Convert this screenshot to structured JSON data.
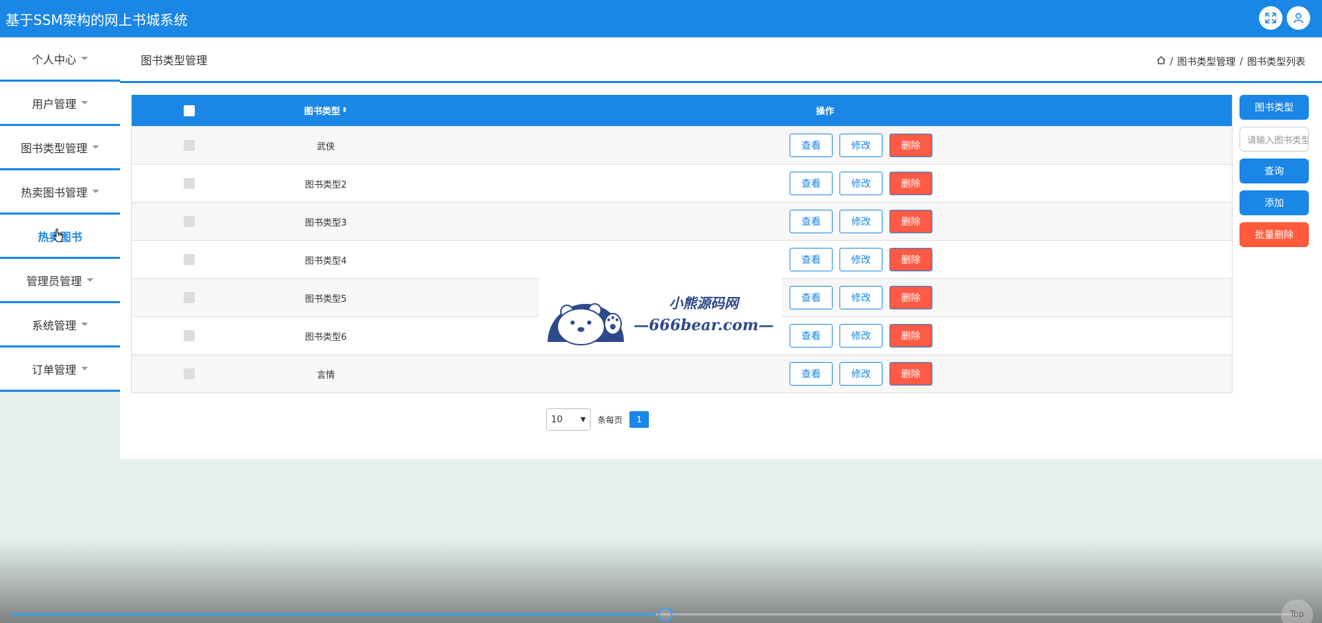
{
  "app": {
    "title": "基于SSM架构的网上书城系统"
  },
  "colors": {
    "primary": "#1a86e6",
    "danger": "#ff5a44"
  },
  "sidebar": {
    "items": [
      {
        "label": "个人中心",
        "caret": true
      },
      {
        "label": "用户管理",
        "caret": true
      },
      {
        "label": "图书类型管理",
        "caret": true
      },
      {
        "label": "热卖图书管理",
        "caret": true
      },
      {
        "label": "热卖图书",
        "caret": false,
        "active": true
      },
      {
        "label": "管理员管理",
        "caret": true
      },
      {
        "label": "系统管理",
        "caret": true
      },
      {
        "label": "订单管理",
        "caret": true
      }
    ]
  },
  "page": {
    "title": "图书类型管理",
    "breadcrumb": [
      "图书类型管理",
      "图书类型列表"
    ],
    "separator": "/"
  },
  "table": {
    "headers": {
      "type": "图书类型",
      "ops": "操作"
    },
    "rows": [
      {
        "type": "武侠"
      },
      {
        "type": "图书类型2"
      },
      {
        "type": "图书类型3"
      },
      {
        "type": "图书类型4"
      },
      {
        "type": "图书类型5"
      },
      {
        "type": "图书类型6"
      },
      {
        "type": "言情"
      }
    ],
    "actions": {
      "view": "查看",
      "edit": "修改",
      "delete": "删除"
    }
  },
  "pager": {
    "page_size": "10",
    "per_page_label": "条每页",
    "current_page": "1"
  },
  "right_panel": {
    "type_label": "图书类型",
    "search_placeholder": "请输入图书类型",
    "query": "查询",
    "add": "添加",
    "batch_delete": "批量删除"
  },
  "watermark": {
    "line1": "小熊源码网",
    "line2": "—666bear.com—"
  },
  "video": {
    "progress": 0.5,
    "top_label": "Top"
  }
}
